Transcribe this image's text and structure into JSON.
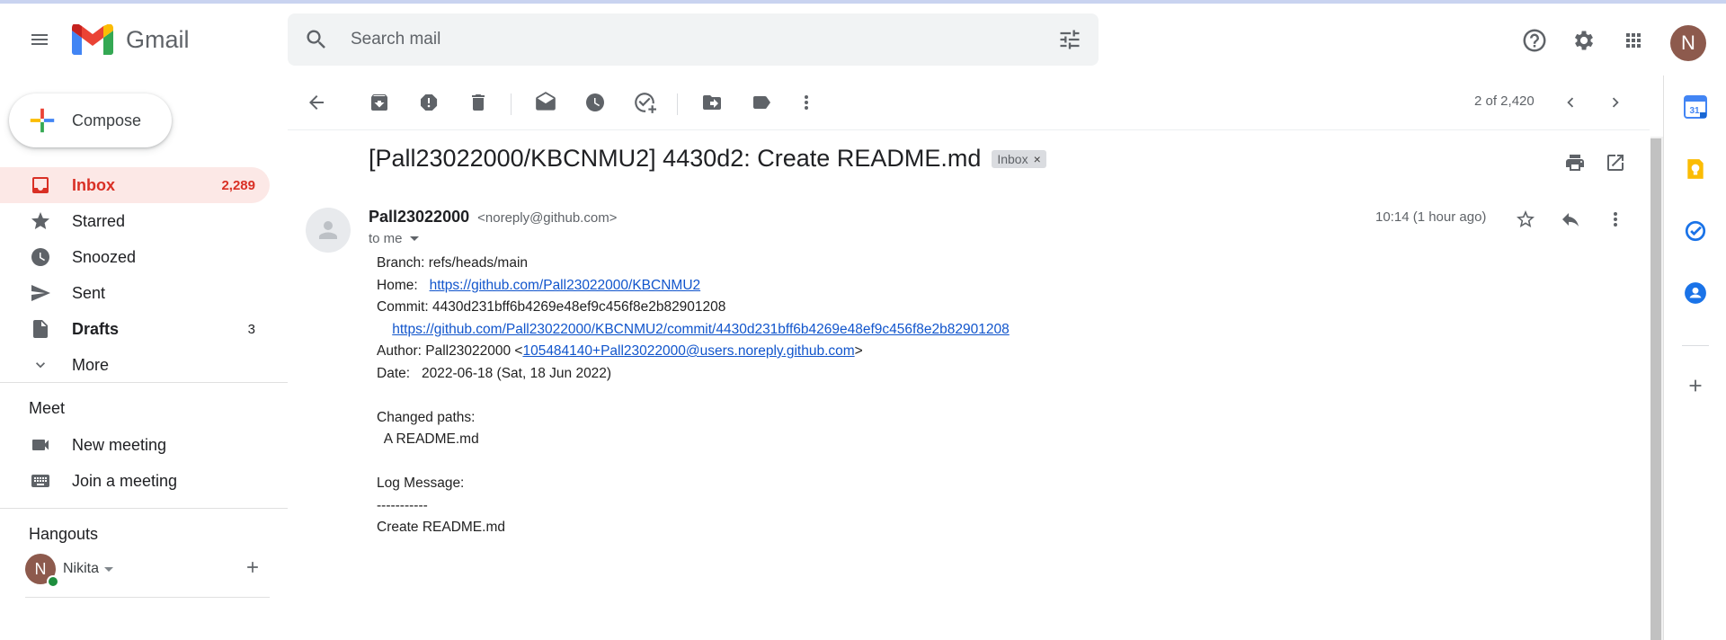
{
  "app": {
    "name": "Gmail"
  },
  "search": {
    "placeholder": "Search mail"
  },
  "header": {
    "avatar_initial": "N"
  },
  "compose": {
    "label": "Compose"
  },
  "nav": [
    {
      "label": "Inbox",
      "count": "2,289",
      "icon": "inbox-icon"
    },
    {
      "label": "Starred",
      "count": "",
      "icon": "star-icon"
    },
    {
      "label": "Snoozed",
      "count": "",
      "icon": "clock-icon"
    },
    {
      "label": "Sent",
      "count": "",
      "icon": "send-icon"
    },
    {
      "label": "Drafts",
      "count": "3",
      "icon": "draft-icon"
    },
    {
      "label": "More",
      "count": "",
      "icon": "chevron-down-icon"
    }
  ],
  "meet": {
    "title": "Meet",
    "items": [
      {
        "label": "New meeting",
        "icon": "video-icon"
      },
      {
        "label": "Join a meeting",
        "icon": "keyboard-icon"
      }
    ]
  },
  "hangouts": {
    "title": "Hangouts",
    "user": "Nikita",
    "avatar_initial": "N"
  },
  "toolbar": {
    "pager": "2 of 2,420"
  },
  "email": {
    "subject": "[Pall23022000/KBCNMU2] 4430d2: Create README.md",
    "label_chip": "Inbox",
    "sender_name": "Pall23022000",
    "sender_email": "<noreply@github.com>",
    "to": "to me",
    "time": "10:14 (1 hour ago)",
    "body": {
      "branch": "Branch: refs/heads/main",
      "home_prefix": "Home:   ",
      "home_link": "https://github.com/Pall23022000/KBCNMU2",
      "commit": "Commit: 4430d231bff6b4269e48ef9c456f8e2b82901208",
      "commit_indent": "    ",
      "commit_link": "https://github.com/Pall23022000/KBCNMU2/commit/4430d231bff6b4269e48ef9c456f8e2b82901208",
      "author_prefix": "Author: Pall23022000 <",
      "author_link": "105484140+Pall23022000@users.noreply.github.com",
      "author_suffix": ">",
      "date": "Date:   2022-06-18 (Sat, 18 Jun 2022)",
      "changed_title": "Changed paths:",
      "changed_item": "  A README.md",
      "log_title": "Log Message:",
      "log_sep": "-----------",
      "log_msg": "Create README.md"
    }
  },
  "sidepanel": {
    "calendar_day": "31"
  }
}
